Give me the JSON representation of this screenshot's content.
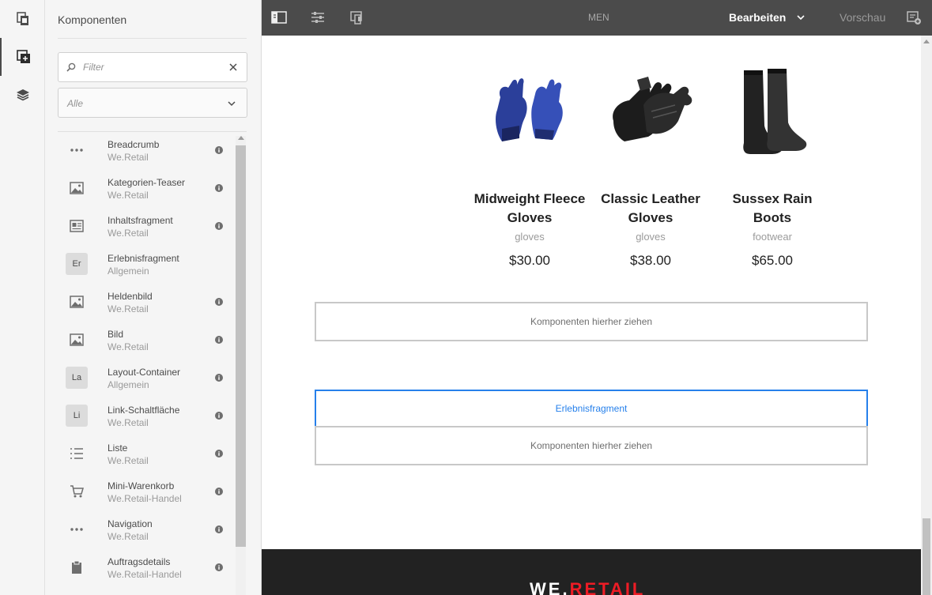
{
  "rail": {
    "items": [
      {
        "icon": "page-templates-icon"
      },
      {
        "icon": "add-component-icon",
        "active": true
      },
      {
        "icon": "layers-icon"
      }
    ]
  },
  "panel": {
    "title": "Komponenten",
    "filter_placeholder": "Filter",
    "group_select_value": "Alle",
    "components": [
      {
        "name": "Breadcrumb",
        "group": "We.Retail",
        "icon": "more-horizontal-icon",
        "info": true
      },
      {
        "name": "Kategorien-Teaser",
        "group": "We.Retail",
        "icon": "image-icon",
        "info": true
      },
      {
        "name": "Inhaltsfragment",
        "group": "We.Retail",
        "icon": "content-fragment-icon",
        "info": true
      },
      {
        "name": "Erlebnisfragment",
        "group": "Allgemein",
        "abbr": "Er",
        "info": false
      },
      {
        "name": "Heldenbild",
        "group": "We.Retail",
        "icon": "image-icon",
        "info": true
      },
      {
        "name": "Bild",
        "group": "We.Retail",
        "icon": "image-icon",
        "info": true
      },
      {
        "name": "Layout-Container",
        "group": "Allgemein",
        "abbr": "La",
        "info": true
      },
      {
        "name": "Link-Schaltfläche",
        "group": "We.Retail",
        "abbr": "Li",
        "info": true
      },
      {
        "name": "Liste",
        "group": "We.Retail",
        "icon": "list-icon",
        "info": true
      },
      {
        "name": "Mini-Warenkorb",
        "group": "We.Retail-Handel",
        "icon": "cart-icon",
        "info": true
      },
      {
        "name": "Navigation",
        "group": "We.Retail",
        "icon": "more-horizontal-icon",
        "info": true
      },
      {
        "name": "Auftragsdetails",
        "group": "We.Retail-Handel",
        "icon": "clipboard-icon",
        "info": true
      }
    ]
  },
  "toolbar": {
    "center_label": "MEN",
    "mode_label": "Bearbeiten",
    "preview_label": "Vorschau"
  },
  "canvas": {
    "products": [
      {
        "name": "Midweight Fleece Gloves",
        "category": "gloves",
        "price": "$30.00",
        "image": "blue-gloves"
      },
      {
        "name": "Classic Leather Gloves",
        "category": "gloves",
        "price": "$38.00",
        "image": "black-leather-gloves"
      },
      {
        "name": "Sussex Rain Boots",
        "category": "footwear",
        "price": "$65.00",
        "image": "rain-boots"
      }
    ],
    "drop_zone_1": "Komponenten hierher ziehen",
    "fragment_label": "Erlebnisfragment",
    "drop_zone_2": "Komponenten hierher ziehen",
    "logo_white": "WE.",
    "logo_red": "RETAIL"
  }
}
